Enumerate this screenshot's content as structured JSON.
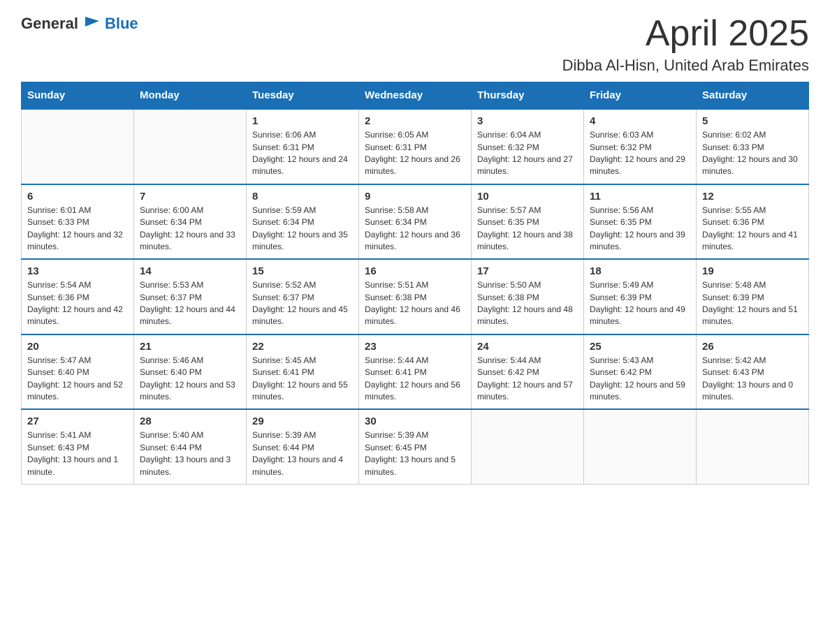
{
  "header": {
    "logo_general": "General",
    "logo_blue": "Blue",
    "month_title": "April 2025",
    "location": "Dibba Al-Hisn, United Arab Emirates"
  },
  "weekdays": [
    "Sunday",
    "Monday",
    "Tuesday",
    "Wednesday",
    "Thursday",
    "Friday",
    "Saturday"
  ],
  "weeks": [
    [
      {
        "day": "",
        "sunrise": "",
        "sunset": "",
        "daylight": ""
      },
      {
        "day": "",
        "sunrise": "",
        "sunset": "",
        "daylight": ""
      },
      {
        "day": "1",
        "sunrise": "Sunrise: 6:06 AM",
        "sunset": "Sunset: 6:31 PM",
        "daylight": "Daylight: 12 hours and 24 minutes."
      },
      {
        "day": "2",
        "sunrise": "Sunrise: 6:05 AM",
        "sunset": "Sunset: 6:31 PM",
        "daylight": "Daylight: 12 hours and 26 minutes."
      },
      {
        "day": "3",
        "sunrise": "Sunrise: 6:04 AM",
        "sunset": "Sunset: 6:32 PM",
        "daylight": "Daylight: 12 hours and 27 minutes."
      },
      {
        "day": "4",
        "sunrise": "Sunrise: 6:03 AM",
        "sunset": "Sunset: 6:32 PM",
        "daylight": "Daylight: 12 hours and 29 minutes."
      },
      {
        "day": "5",
        "sunrise": "Sunrise: 6:02 AM",
        "sunset": "Sunset: 6:33 PM",
        "daylight": "Daylight: 12 hours and 30 minutes."
      }
    ],
    [
      {
        "day": "6",
        "sunrise": "Sunrise: 6:01 AM",
        "sunset": "Sunset: 6:33 PM",
        "daylight": "Daylight: 12 hours and 32 minutes."
      },
      {
        "day": "7",
        "sunrise": "Sunrise: 6:00 AM",
        "sunset": "Sunset: 6:34 PM",
        "daylight": "Daylight: 12 hours and 33 minutes."
      },
      {
        "day": "8",
        "sunrise": "Sunrise: 5:59 AM",
        "sunset": "Sunset: 6:34 PM",
        "daylight": "Daylight: 12 hours and 35 minutes."
      },
      {
        "day": "9",
        "sunrise": "Sunrise: 5:58 AM",
        "sunset": "Sunset: 6:34 PM",
        "daylight": "Daylight: 12 hours and 36 minutes."
      },
      {
        "day": "10",
        "sunrise": "Sunrise: 5:57 AM",
        "sunset": "Sunset: 6:35 PM",
        "daylight": "Daylight: 12 hours and 38 minutes."
      },
      {
        "day": "11",
        "sunrise": "Sunrise: 5:56 AM",
        "sunset": "Sunset: 6:35 PM",
        "daylight": "Daylight: 12 hours and 39 minutes."
      },
      {
        "day": "12",
        "sunrise": "Sunrise: 5:55 AM",
        "sunset": "Sunset: 6:36 PM",
        "daylight": "Daylight: 12 hours and 41 minutes."
      }
    ],
    [
      {
        "day": "13",
        "sunrise": "Sunrise: 5:54 AM",
        "sunset": "Sunset: 6:36 PM",
        "daylight": "Daylight: 12 hours and 42 minutes."
      },
      {
        "day": "14",
        "sunrise": "Sunrise: 5:53 AM",
        "sunset": "Sunset: 6:37 PM",
        "daylight": "Daylight: 12 hours and 44 minutes."
      },
      {
        "day": "15",
        "sunrise": "Sunrise: 5:52 AM",
        "sunset": "Sunset: 6:37 PM",
        "daylight": "Daylight: 12 hours and 45 minutes."
      },
      {
        "day": "16",
        "sunrise": "Sunrise: 5:51 AM",
        "sunset": "Sunset: 6:38 PM",
        "daylight": "Daylight: 12 hours and 46 minutes."
      },
      {
        "day": "17",
        "sunrise": "Sunrise: 5:50 AM",
        "sunset": "Sunset: 6:38 PM",
        "daylight": "Daylight: 12 hours and 48 minutes."
      },
      {
        "day": "18",
        "sunrise": "Sunrise: 5:49 AM",
        "sunset": "Sunset: 6:39 PM",
        "daylight": "Daylight: 12 hours and 49 minutes."
      },
      {
        "day": "19",
        "sunrise": "Sunrise: 5:48 AM",
        "sunset": "Sunset: 6:39 PM",
        "daylight": "Daylight: 12 hours and 51 minutes."
      }
    ],
    [
      {
        "day": "20",
        "sunrise": "Sunrise: 5:47 AM",
        "sunset": "Sunset: 6:40 PM",
        "daylight": "Daylight: 12 hours and 52 minutes."
      },
      {
        "day": "21",
        "sunrise": "Sunrise: 5:46 AM",
        "sunset": "Sunset: 6:40 PM",
        "daylight": "Daylight: 12 hours and 53 minutes."
      },
      {
        "day": "22",
        "sunrise": "Sunrise: 5:45 AM",
        "sunset": "Sunset: 6:41 PM",
        "daylight": "Daylight: 12 hours and 55 minutes."
      },
      {
        "day": "23",
        "sunrise": "Sunrise: 5:44 AM",
        "sunset": "Sunset: 6:41 PM",
        "daylight": "Daylight: 12 hours and 56 minutes."
      },
      {
        "day": "24",
        "sunrise": "Sunrise: 5:44 AM",
        "sunset": "Sunset: 6:42 PM",
        "daylight": "Daylight: 12 hours and 57 minutes."
      },
      {
        "day": "25",
        "sunrise": "Sunrise: 5:43 AM",
        "sunset": "Sunset: 6:42 PM",
        "daylight": "Daylight: 12 hours and 59 minutes."
      },
      {
        "day": "26",
        "sunrise": "Sunrise: 5:42 AM",
        "sunset": "Sunset: 6:43 PM",
        "daylight": "Daylight: 13 hours and 0 minutes."
      }
    ],
    [
      {
        "day": "27",
        "sunrise": "Sunrise: 5:41 AM",
        "sunset": "Sunset: 6:43 PM",
        "daylight": "Daylight: 13 hours and 1 minute."
      },
      {
        "day": "28",
        "sunrise": "Sunrise: 5:40 AM",
        "sunset": "Sunset: 6:44 PM",
        "daylight": "Daylight: 13 hours and 3 minutes."
      },
      {
        "day": "29",
        "sunrise": "Sunrise: 5:39 AM",
        "sunset": "Sunset: 6:44 PM",
        "daylight": "Daylight: 13 hours and 4 minutes."
      },
      {
        "day": "30",
        "sunrise": "Sunrise: 5:39 AM",
        "sunset": "Sunset: 6:45 PM",
        "daylight": "Daylight: 13 hours and 5 minutes."
      },
      {
        "day": "",
        "sunrise": "",
        "sunset": "",
        "daylight": ""
      },
      {
        "day": "",
        "sunrise": "",
        "sunset": "",
        "daylight": ""
      },
      {
        "day": "",
        "sunrise": "",
        "sunset": "",
        "daylight": ""
      }
    ]
  ]
}
